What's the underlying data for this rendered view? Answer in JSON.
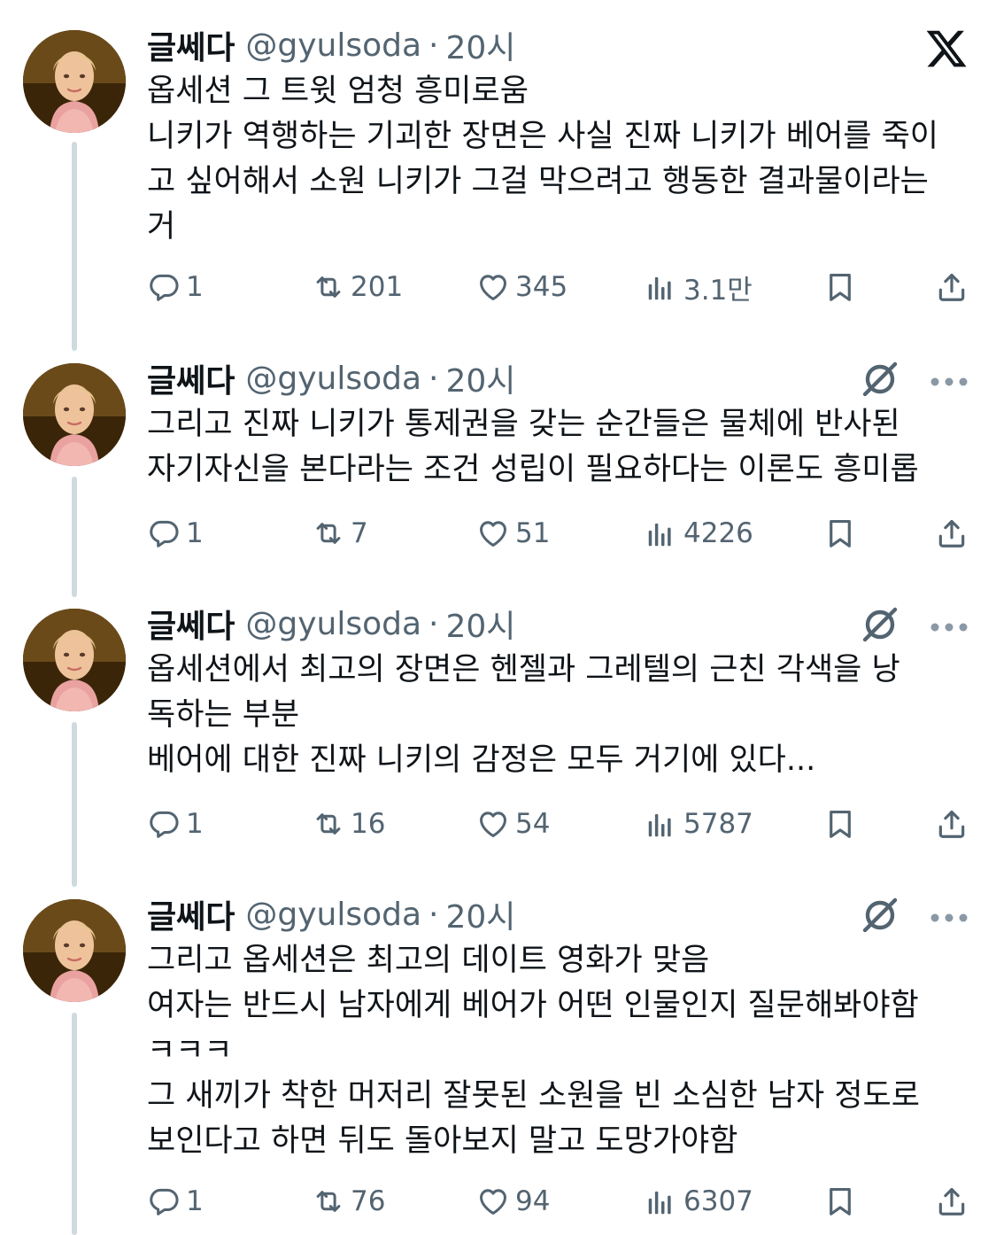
{
  "tweets": [
    {
      "name": "글쎄다",
      "handle": "@gyulsoda",
      "dot": "·",
      "time": "20시",
      "lines": [
        "옵세션 그 트윗 엄청 흥미로움",
        "니키가 역행하는 기괴한 장면은 사실 진짜 니키가 베어를 죽이",
        "고 싶어해서 소원 니키가 그걸 막으려고 행동한 결과물이라는",
        "거"
      ],
      "replies": "1",
      "reposts": "201",
      "likes": "345",
      "views": "3.1만"
    },
    {
      "name": "글쎄다",
      "handle": "@gyulsoda",
      "dot": "·",
      "time": "20시",
      "lines": [
        "그리고 진짜 니키가 통제권을 갖는 순간들은 물체에 반사된",
        "자기자신을 본다라는 조건 성립이 필요하다는 이론도 흥미롭"
      ],
      "replies": "1",
      "reposts": "7",
      "likes": "51",
      "views": "4226"
    },
    {
      "name": "글쎄다",
      "handle": "@gyulsoda",
      "dot": "·",
      "time": "20시",
      "lines": [
        "옵세션에서 최고의 장면은 헨젤과 그레텔의 근친 각색을 낭",
        "독하는 부분",
        "베어에 대한 진짜 니키의 감정은 모두 거기에 있다..."
      ],
      "replies": "1",
      "reposts": "16",
      "likes": "54",
      "views": "5787"
    },
    {
      "name": "글쎄다",
      "handle": "@gyulsoda",
      "dot": "·",
      "time": "20시",
      "lines": [
        "그리고 옵세션은 최고의 데이트 영화가 맞음",
        "여자는 반드시 남자에게 베어가 어떤 인물인지 질문해봐야함",
        "ㅋㅋㅋ",
        "그 새끼가 착한 머저리 잘못된 소원을 빈 소심한 남자 정도로",
        "보인다고 하면 뒤도 돌아보지 말고 도망가야함"
      ],
      "replies": "1",
      "reposts": "76",
      "likes": "94",
      "views": "6307"
    }
  ],
  "icons": {
    "brand": "x-logo-icon",
    "grok": "grok-icon",
    "more": "more-icon",
    "reply": "reply-icon",
    "repost": "repost-icon",
    "like": "like-icon",
    "views": "views-icon",
    "bookmark": "bookmark-icon",
    "share": "share-icon"
  },
  "colors": {
    "text": "#0f1419",
    "secondary": "#536471",
    "thread_line": "#cfd9de"
  }
}
